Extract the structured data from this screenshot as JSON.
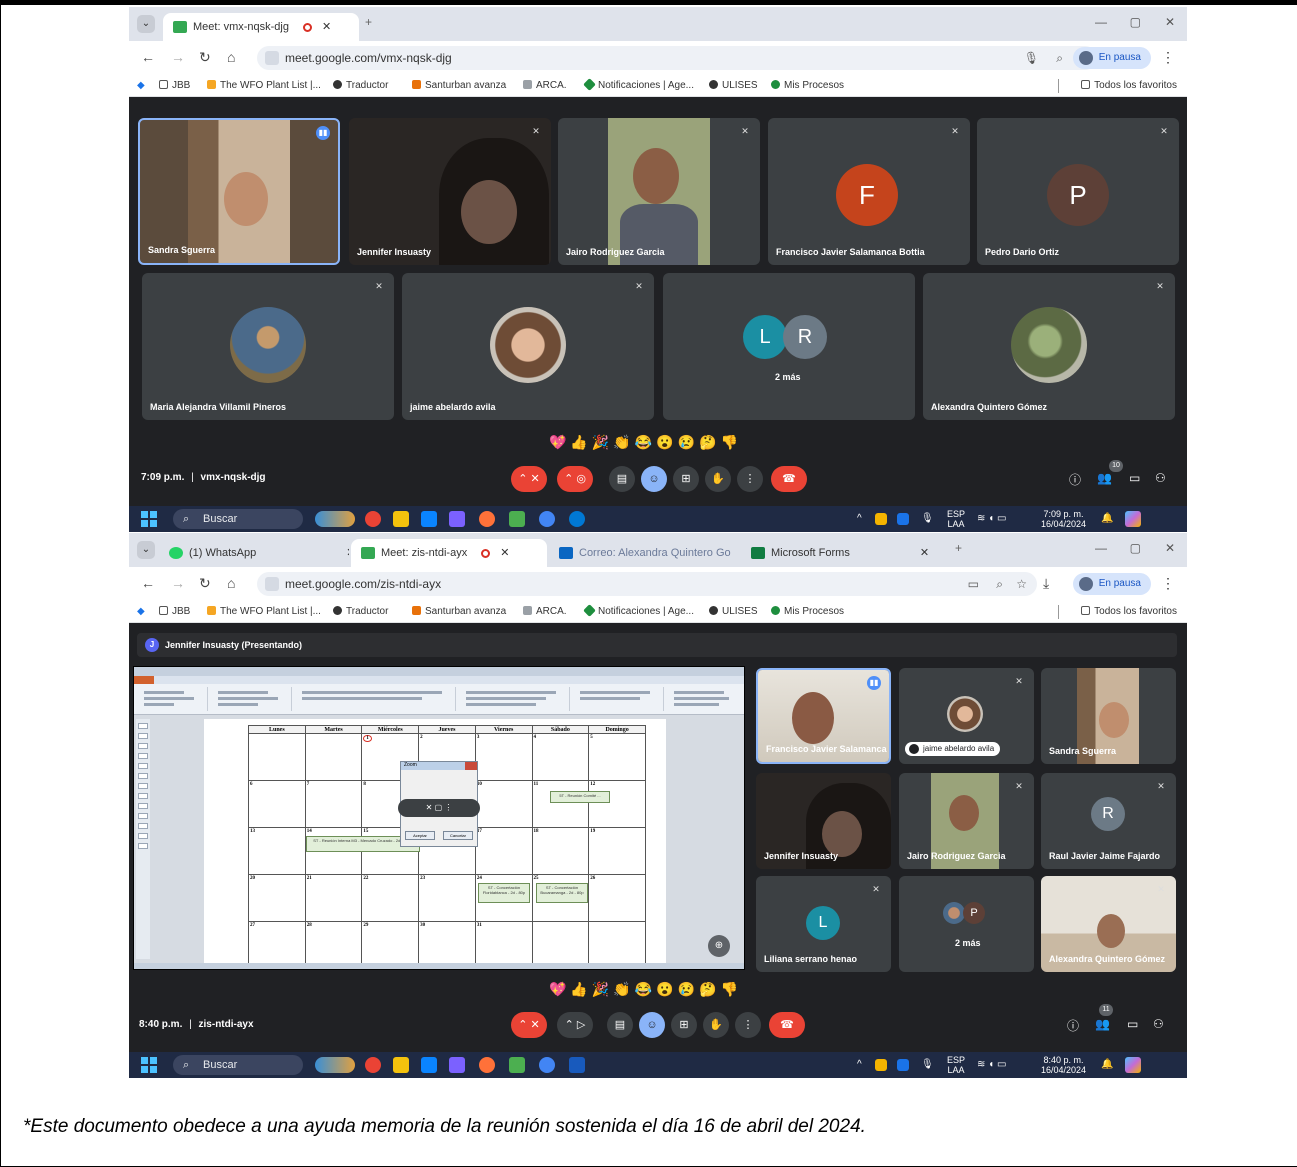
{
  "colors": {
    "meet_bg": "#202124",
    "tile_bg": "#3c4043",
    "end_call": "#ea4335",
    "speaking_border": "#8ab4f8",
    "avatar_f": "#c5441c",
    "avatar_p": "#5d4037",
    "avatar_l": "#1b8fa3",
    "avatar_r": "#6c7a86"
  },
  "screen1": {
    "tab_title": "Meet: vmx-nqsk-djg",
    "url": "meet.google.com/vmx-nqsk-djg",
    "profile_status": "En pausa",
    "bookmarks": [
      "JBB",
      "The WFO Plant List |...",
      "Traductor",
      "Santurban avanza",
      "ARCA.",
      "Notificaciones | Age...",
      "ULISES",
      "Mis Procesos"
    ],
    "all_bookmarks": "Todos los favoritos",
    "participants": [
      {
        "name": "Sandra Sguerra"
      },
      {
        "name": "Jennifer Insuasty"
      },
      {
        "name": "Jairo Rodriguez Garcia"
      },
      {
        "name": "Francisco Javier Salamanca Bottia",
        "initial": "F"
      },
      {
        "name": "Pedro Dario Ortiz",
        "initial": "P"
      },
      {
        "name": "Maria Alejandra Villamil Pineros"
      },
      {
        "name": "jaime abelardo avila"
      },
      {
        "name": "",
        "initials": [
          "L",
          "R"
        ],
        "more": "2 más"
      },
      {
        "name": "Alexandra Quintero Gómez"
      }
    ],
    "reactions": "💖👍🎉👏😂😮😢🤔👎",
    "time": "7:09 p.m.",
    "separator": "|",
    "meeting_code": "vmx-nqsk-djg",
    "people_count": "10",
    "taskbar": {
      "search": "Buscar",
      "lang1": "ESP",
      "lang2": "LAA",
      "clock_time": "7:09 p. m.",
      "clock_date": "16/04/2024"
    }
  },
  "screen2": {
    "tabs": [
      "(1) WhatsApp",
      "Meet: zis-ntdi-ayx",
      "Correo: Alexandra Quintero Go",
      "Microsoft Forms"
    ],
    "url": "meet.google.com/zis-ntdi-ayx",
    "profile_status": "En pausa",
    "bookmarks": [
      "JBB",
      "The WFO Plant List |...",
      "Traductor",
      "Santurban avanza",
      "ARCA.",
      "Notificaciones | Age...",
      "ULISES",
      "Mis Procesos"
    ],
    "all_bookmarks": "Todos los favoritos",
    "presenter_initial": "J",
    "presenting": "Jennifer Insuasty (Presentando)",
    "calendar": {
      "headers": [
        "Lunes",
        "Martes",
        "Miércoles",
        "Jueves",
        "Viernes",
        "Sábado",
        "Domingo"
      ],
      "weeks": [
        [
          "",
          "",
          "1",
          "2",
          "3",
          "4",
          "5"
        ],
        [
          "6",
          "7",
          "8",
          "9",
          "10",
          "11",
          "12"
        ],
        [
          "13",
          "14",
          "15",
          "16",
          "17",
          "18",
          "19"
        ],
        [
          "20",
          "21",
          "22",
          "23",
          "24",
          "25",
          "26"
        ],
        [
          "27",
          "28",
          "29",
          "30",
          "31",
          "",
          ""
        ]
      ],
      "events": [
        "5T - Reunión Comité ...",
        "ST - Reunión Interna M3 - Mercado Cruzado - 2d - 102p",
        "ST - Concertación Floridablanca - 2d - 80p",
        "ST - Concertación Bucaramanga - 2d - 80p"
      ],
      "dialog_title": "Zoom",
      "dialog_ok": "Aceptar",
      "dialog_cancel": "Cancelar"
    },
    "participants": [
      {
        "name": "Francisco Javier Salamanca"
      },
      {
        "name": "jaime abelardo avila"
      },
      {
        "name": "Sandra Sguerra"
      },
      {
        "name": "Jennifer Insuasty"
      },
      {
        "name": "Jairo Rodriguez Garcia"
      },
      {
        "name": "Raul Javier Jaime Fajardo",
        "initial": "R"
      },
      {
        "name": "Liliana serrano henao",
        "initial": "L"
      },
      {
        "name": "",
        "initial": "P",
        "more": "2 más"
      },
      {
        "name": "Alexandra Quintero Gómez"
      }
    ],
    "reactions": "💖👍🎉👏😂😮😢🤔👎",
    "time": "8:40 p.m.",
    "separator": "|",
    "meeting_code": "zis-ntdi-ayx",
    "people_count": "11",
    "taskbar": {
      "search": "Buscar",
      "lang1": "ESP",
      "lang2": "LAA",
      "clock_time": "8:40 p. m.",
      "clock_date": "16/04/2024"
    }
  },
  "caption": "*Este documento obedece a una ayuda memoria de la reunión sostenida el día 16 de abril del 2024."
}
